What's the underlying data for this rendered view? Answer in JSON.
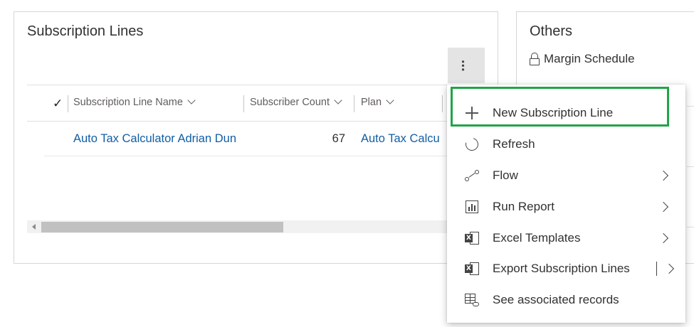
{
  "subscription_panel": {
    "title": "Subscription Lines",
    "more_label": "...",
    "columns": [
      {
        "label": "Subscription Line Name"
      },
      {
        "label": "Subscriber Count"
      },
      {
        "label": "Plan"
      }
    ],
    "rows": [
      {
        "name": "Auto Tax Calculator Adrian Dun",
        "subscriber_count": "67",
        "plan": "Auto Tax Calcu"
      }
    ]
  },
  "others_panel": {
    "title": "Others",
    "items": [
      {
        "label": "Margin Schedule",
        "icon": "lock-icon"
      }
    ]
  },
  "context_menu": {
    "items": [
      {
        "label": "New Subscription Line",
        "icon": "plus-icon",
        "highlighted": true
      },
      {
        "label": "Refresh",
        "icon": "refresh-icon"
      },
      {
        "label": "Flow",
        "icon": "flow-icon",
        "submenu": true
      },
      {
        "label": "Run Report",
        "icon": "report-icon",
        "submenu": true
      },
      {
        "label": "Excel Templates",
        "icon": "excel-icon",
        "submenu": true
      },
      {
        "label": "Export Subscription Lines",
        "icon": "excel-export-icon",
        "split_submenu": true
      },
      {
        "label": "See associated records",
        "icon": "associated-records-icon"
      }
    ],
    "highlight_color": "#20a448"
  },
  "colors": {
    "link": "#115ea3",
    "text": "#323130",
    "header_text": "#605e5c"
  }
}
